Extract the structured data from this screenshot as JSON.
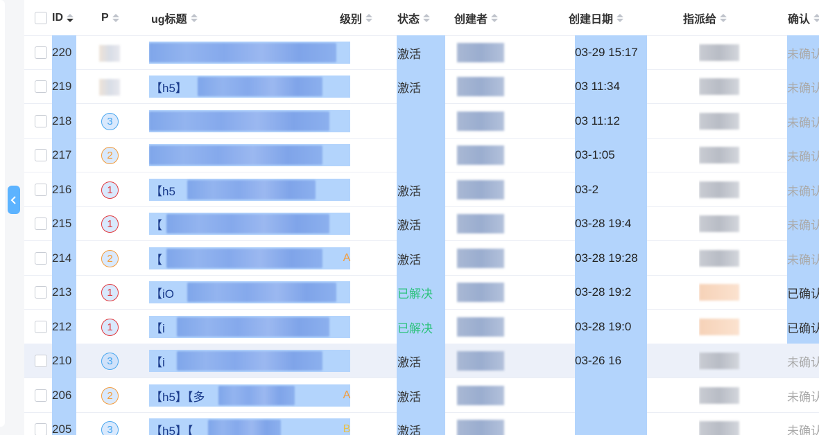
{
  "table": {
    "headers": {
      "id": "ID",
      "priority": "P",
      "title": "ug标题",
      "level": "级别",
      "status": "状态",
      "creator": "创建者",
      "created_date": "创建日期",
      "assignee": "指派给",
      "confirm": "确认"
    },
    "rows": [
      {
        "id": "220",
        "priority": "",
        "title_prefix": "",
        "level": "",
        "status": "激活",
        "date": "03-29 15:17",
        "confirm": "未确认"
      },
      {
        "id": "219",
        "priority": "",
        "title_prefix": "【h5】",
        "level": "",
        "status": "激活",
        "date": "03 11:34",
        "confirm": "未确认"
      },
      {
        "id": "218",
        "priority": "3",
        "title_prefix": "",
        "level": "",
        "status": "",
        "date": "03 11:12",
        "confirm": "未确认"
      },
      {
        "id": "217",
        "priority": "2",
        "title_prefix": "",
        "level": "",
        "status": "",
        "date": "03-1:05",
        "confirm": "未确认"
      },
      {
        "id": "216",
        "priority": "1",
        "title_prefix": "【h5",
        "level": "",
        "status": "激活",
        "date": "03-2",
        "confirm": "未确认"
      },
      {
        "id": "215",
        "priority": "1",
        "title_prefix": "【",
        "level": "",
        "status": "激活",
        "date": "03-28 19:4",
        "confirm": "未确认"
      },
      {
        "id": "214",
        "priority": "2",
        "title_prefix": "【",
        "level": "A",
        "status": "激活",
        "date": "03-28 19:28",
        "confirm": "未确认"
      },
      {
        "id": "213",
        "priority": "1",
        "title_prefix": "【iO",
        "level": "",
        "status": "已解决",
        "date": "03-28 19:2",
        "confirm": "已确认"
      },
      {
        "id": "212",
        "priority": "1",
        "title_prefix": "【i",
        "level": "",
        "status": "已解决",
        "date": "03-28 19:0",
        "confirm": "已确认"
      },
      {
        "id": "210",
        "priority": "3",
        "title_prefix": "【i",
        "level": "",
        "status": "激活",
        "date": "03-26 16",
        "confirm": "未确认"
      },
      {
        "id": "206",
        "priority": "2",
        "title_prefix": "【h5】【多",
        "level": "A",
        "status": "激活",
        "date": "",
        "confirm": "未确认"
      },
      {
        "id": "205",
        "priority": "3",
        "title_prefix": "【h5】【",
        "level": "B",
        "status": "激活",
        "date": "",
        "confirm": "未确认"
      }
    ]
  },
  "colors": {
    "selection": "#b3d4fc",
    "resolved": "#2ec27e",
    "p1": "#e0393e",
    "p2": "#f39c3c",
    "p3": "#4aa7ef",
    "collapse_button": "#5cb3ff"
  },
  "icons": {
    "collapse": "chevron-left-icon",
    "sort": "sort-caret-icon"
  }
}
